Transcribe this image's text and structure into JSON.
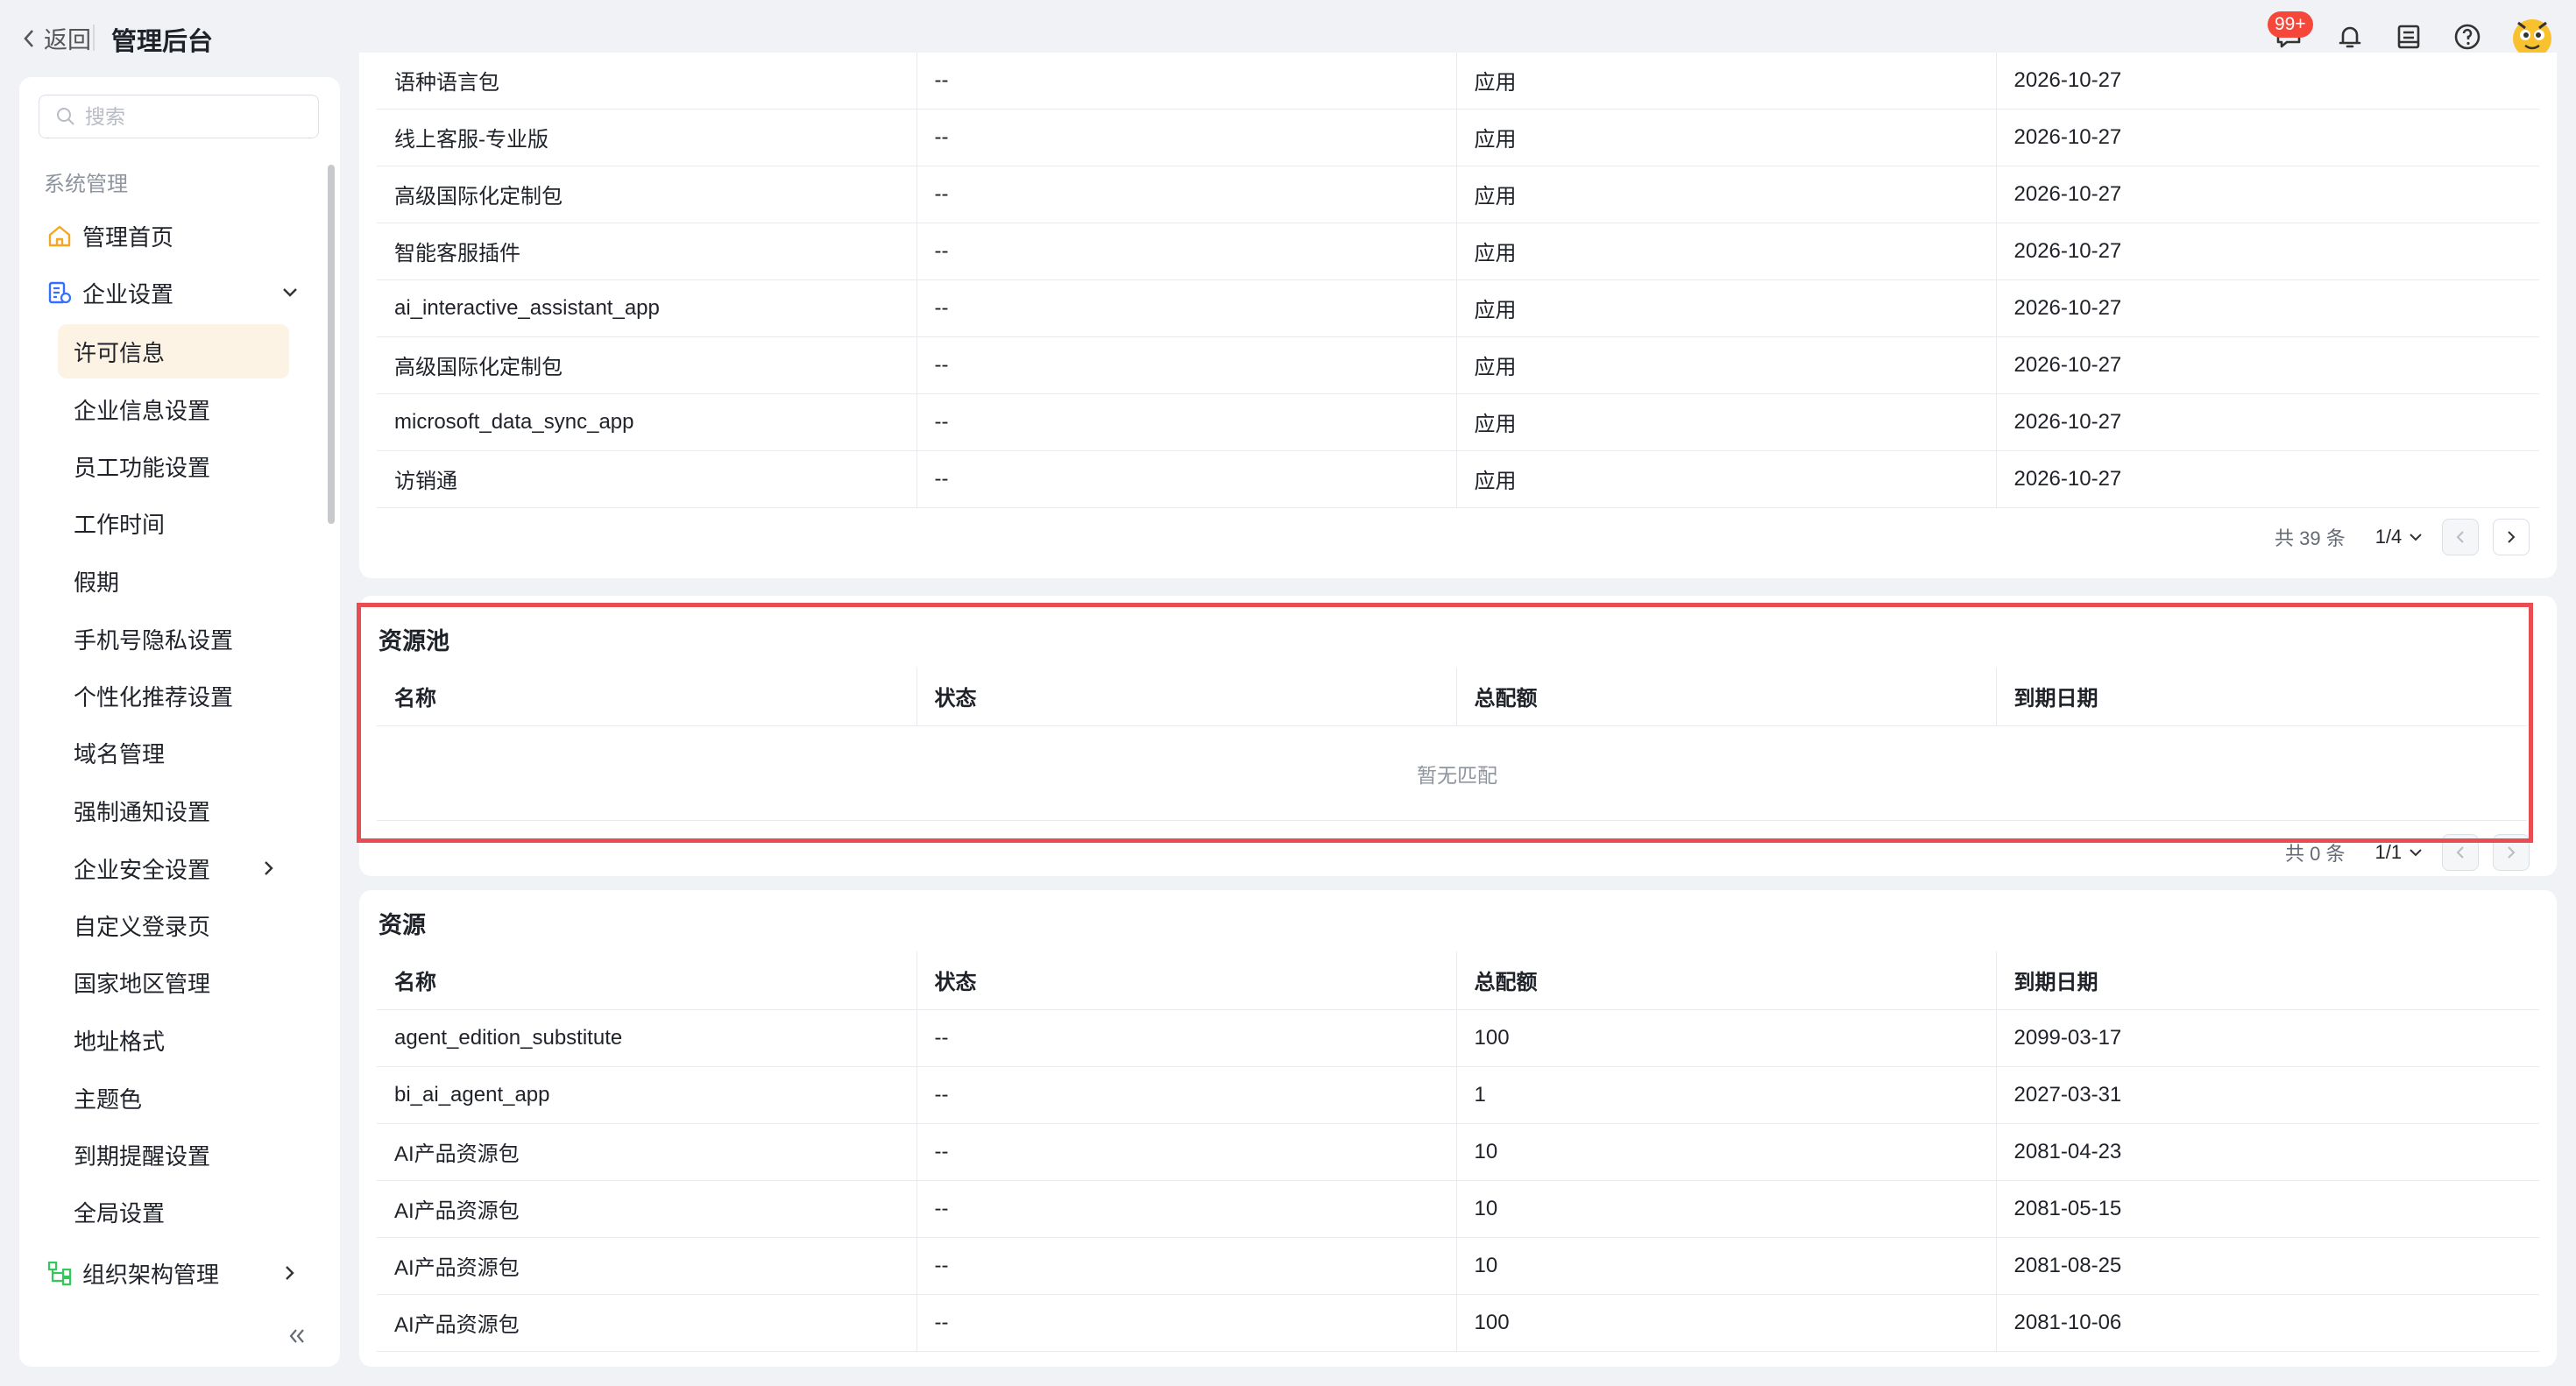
{
  "topbar": {
    "back_label": "返回",
    "title": "管理后台",
    "badge": "99+",
    "icons": [
      "message-icon",
      "bell-icon",
      "inbox-icon",
      "help-icon",
      "avatar"
    ]
  },
  "sidebar": {
    "search_placeholder": "搜索",
    "section": "系统管理",
    "home": "管理首页",
    "enterprise": "企业设置",
    "sub_items": [
      "许可信息",
      "企业信息设置",
      "员工功能设置",
      "工作时间",
      "假期",
      "手机号隐私设置",
      "个性化推荐设置",
      "域名管理",
      "强制通知设置",
      "企业安全设置",
      "自定义登录页",
      "国家地区管理",
      "地址格式",
      "主题色",
      "到期提醒设置",
      "全局设置"
    ],
    "org": "组织架构管理"
  },
  "apps_table": {
    "rows": [
      [
        "语种语言包",
        "--",
        "应用",
        "2026-10-27"
      ],
      [
        "线上客服-专业版",
        "--",
        "应用",
        "2026-10-27"
      ],
      [
        "高级国际化定制包",
        "--",
        "应用",
        "2026-10-27"
      ],
      [
        "智能客服插件",
        "--",
        "应用",
        "2026-10-27"
      ],
      [
        "ai_interactive_assistant_app",
        "--",
        "应用",
        "2026-10-27"
      ],
      [
        "高级国际化定制包",
        "--",
        "应用",
        "2026-10-27"
      ],
      [
        "microsoft_data_sync_app",
        "--",
        "应用",
        "2026-10-27"
      ],
      [
        "访销通",
        "--",
        "应用",
        "2026-10-27"
      ]
    ],
    "total": "共 39 条",
    "page": "1/4"
  },
  "pool": {
    "title": "资源池",
    "headers": [
      "名称",
      "状态",
      "总配额",
      "到期日期"
    ],
    "empty": "暂无匹配",
    "total": "共 0 条",
    "page": "1/1"
  },
  "resources": {
    "title": "资源",
    "headers": [
      "名称",
      "状态",
      "总配额",
      "到期日期"
    ],
    "rows": [
      [
        "agent_edition_substitute",
        "--",
        "100",
        "2099-03-17"
      ],
      [
        "bi_ai_agent_app",
        "--",
        "1",
        "2027-03-31"
      ],
      [
        "AI产品资源包",
        "--",
        "10",
        "2081-04-23"
      ],
      [
        "AI产品资源包",
        "--",
        "10",
        "2081-05-15"
      ],
      [
        "AI产品资源包",
        "--",
        "10",
        "2081-08-25"
      ],
      [
        "AI产品资源包",
        "--",
        "100",
        "2081-10-06"
      ]
    ]
  },
  "colors": {
    "accent": "#f5a623",
    "active_bg": "#fdf3e4",
    "highlight": "#e84d52",
    "badge": "#f5483b"
  }
}
